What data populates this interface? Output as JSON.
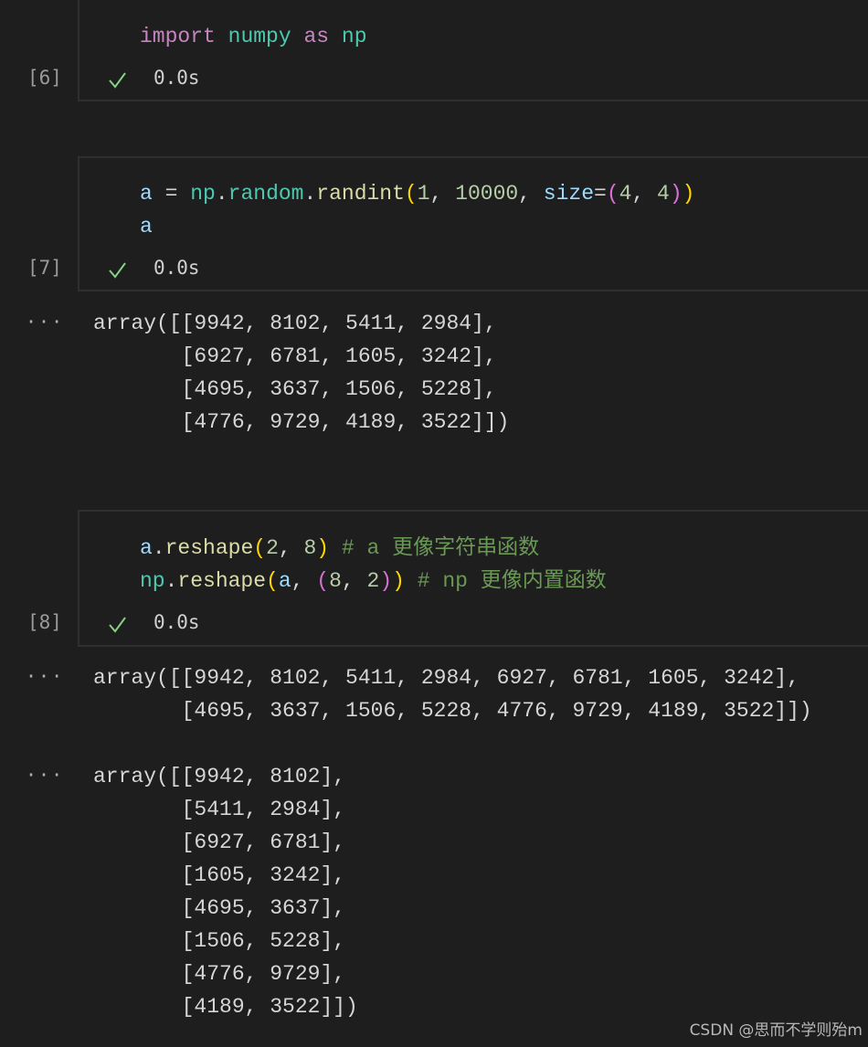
{
  "cells": [
    {
      "exec_label": "[6]",
      "time": "0.0s",
      "code_lines": [
        [
          {
            "t": "import",
            "c": "kw"
          },
          {
            "t": " ",
            "c": "op"
          },
          {
            "t": "numpy",
            "c": "mod"
          },
          {
            "t": " ",
            "c": "op"
          },
          {
            "t": "as",
            "c": "kw"
          },
          {
            "t": " ",
            "c": "op"
          },
          {
            "t": "np",
            "c": "mod"
          }
        ]
      ],
      "outputs": []
    },
    {
      "exec_label": "[7]",
      "time": "0.0s",
      "code_lines": [
        [
          {
            "t": "a",
            "c": "var"
          },
          {
            "t": " = ",
            "c": "op"
          },
          {
            "t": "np",
            "c": "mod"
          },
          {
            "t": ".",
            "c": "op"
          },
          {
            "t": "random",
            "c": "mod"
          },
          {
            "t": ".",
            "c": "op"
          },
          {
            "t": "randint",
            "c": "fn"
          },
          {
            "t": "(",
            "c": "p1"
          },
          {
            "t": "1",
            "c": "num"
          },
          {
            "t": ", ",
            "c": "op"
          },
          {
            "t": "10000",
            "c": "num"
          },
          {
            "t": ", ",
            "c": "op"
          },
          {
            "t": "size",
            "c": "var"
          },
          {
            "t": "=",
            "c": "op"
          },
          {
            "t": "(",
            "c": "p2"
          },
          {
            "t": "4",
            "c": "num"
          },
          {
            "t": ", ",
            "c": "op"
          },
          {
            "t": "4",
            "c": "num"
          },
          {
            "t": ")",
            "c": "p2"
          },
          {
            "t": ")",
            "c": "p1"
          }
        ],
        [
          {
            "t": "a",
            "c": "var"
          }
        ]
      ],
      "outputs": [
        [
          "array([[9942, 8102, 5411, 2984],",
          "       [6927, 6781, 1605, 3242],",
          "       [4695, 3637, 1506, 5228],",
          "       [4776, 9729, 4189, 3522]])"
        ]
      ]
    },
    {
      "exec_label": "[8]",
      "time": "0.0s",
      "code_lines": [
        [
          {
            "t": "a",
            "c": "var"
          },
          {
            "t": ".",
            "c": "op"
          },
          {
            "t": "reshape",
            "c": "fn"
          },
          {
            "t": "(",
            "c": "p1"
          },
          {
            "t": "2",
            "c": "num"
          },
          {
            "t": ", ",
            "c": "op"
          },
          {
            "t": "8",
            "c": "num"
          },
          {
            "t": ")",
            "c": "p1"
          },
          {
            "t": " # a 更像字符串函数",
            "c": "cm"
          }
        ],
        [
          {
            "t": "np",
            "c": "mod"
          },
          {
            "t": ".",
            "c": "op"
          },
          {
            "t": "reshape",
            "c": "fn"
          },
          {
            "t": "(",
            "c": "p1"
          },
          {
            "t": "a",
            "c": "var"
          },
          {
            "t": ", ",
            "c": "op"
          },
          {
            "t": "(",
            "c": "p2"
          },
          {
            "t": "8",
            "c": "num"
          },
          {
            "t": ", ",
            "c": "op"
          },
          {
            "t": "2",
            "c": "num"
          },
          {
            "t": ")",
            "c": "p2"
          },
          {
            "t": ")",
            "c": "p1"
          },
          {
            "t": " # np 更像内置函数",
            "c": "cm"
          }
        ]
      ],
      "outputs": [
        [
          "array([[9942, 8102, 5411, 2984, 6927, 6781, 1605, 3242],",
          "       [4695, 3637, 1506, 5228, 4776, 9729, 4189, 3522]])"
        ],
        [
          "array([[9942, 8102],",
          "       [5411, 2984],",
          "       [6927, 6781],",
          "       [1605, 3242],",
          "       [4695, 3637],",
          "       [1506, 5228],",
          "       [4776, 9729],",
          "       [4189, 3522]])"
        ]
      ]
    }
  ],
  "output_more_glyph": "···",
  "watermark": "CSDN @思而不学则殆m",
  "icons": {
    "check": "check-icon"
  },
  "colors": {
    "check": "#89d185",
    "background": "#1e1e1e"
  }
}
